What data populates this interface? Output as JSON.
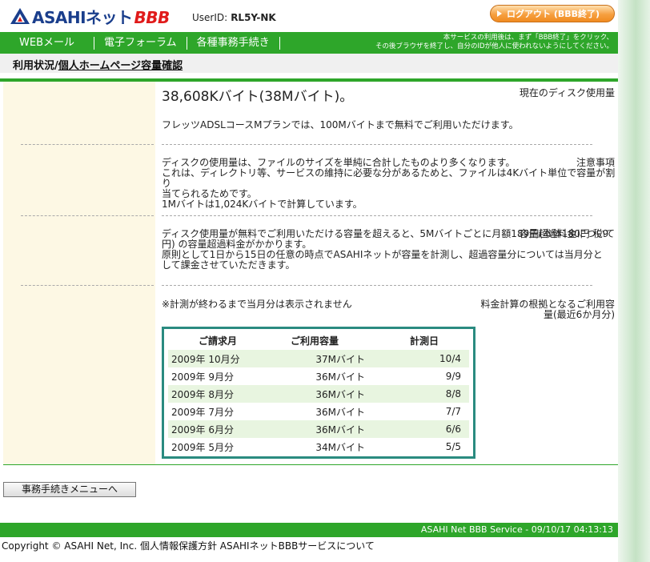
{
  "header": {
    "logo_main": "ASAHIネット",
    "logo_bbb": "BBB",
    "userid_label": "UserID:",
    "userid_value": "RL5Y-NK",
    "logout_label": "ログアウト (BBB終了)"
  },
  "nav": {
    "items": [
      {
        "label": "WEBメール"
      },
      {
        "label": "電子フォーラム"
      },
      {
        "label": "各種事務手続き"
      }
    ],
    "note_line1": "本サービスの利用後は、まず「BBB終了」をクリック、",
    "note_line2": "その後ブラウザを終了し、自分のIDが他人に使われないようにしてください。"
  },
  "breadcrumb": {
    "part1": "利用状況/",
    "part2": "個人ホームページ容量確認"
  },
  "rows": {
    "disk_label": "現在のディスク使用量",
    "disk_value": "38,608Kバイト(38Mバイト)。",
    "disk_note": "フレッツADSLコースMプランでは、100Mバイトまで無料でご利用いただけます。",
    "notice_label": "注意事項",
    "notice_line1": "ディスクの使用量は、ファイルのサイズを単純に合計したものより多くなります。",
    "notice_line2": "これは、ディレクトリ等、サービスの維持に必要な分があるためと、ファイルは4Kバイト単位で容量が割り",
    "notice_line3": "当てられるためです。",
    "notice_line4": "1Mバイトは1,024Kバイトで計算しています。",
    "fee_label": "容量超過料金について",
    "fee_line1": "ディスク使用量が無料でご利用いただける容量を超えると、5Mバイトごとに月額189円(本体180円 税9",
    "fee_line2": "円) の容量超過料金がかかります。",
    "fee_line3": "原則として1日から15日の任意の時点でASAHIネットが容量を計測し、超過容量分については当月分と",
    "fee_line4": "して課金させていただきます。",
    "basis_label_line1": "料金計算の根拠となるご利用容",
    "basis_label_line2": "量(最近6か月分)",
    "basis_note": "※計測が終わるまで当月分は表示されません"
  },
  "table": {
    "headers": [
      "ご請求月",
      "ご利用容量",
      "計測日"
    ],
    "rows": [
      [
        "2009年 10月分",
        "37Mバイト",
        "10/4"
      ],
      [
        "2009年 9月分",
        "36Mバイト",
        "9/9"
      ],
      [
        "2009年 8月分",
        "36Mバイト",
        "8/8"
      ],
      [
        "2009年 7月分",
        "36Mバイト",
        "7/7"
      ],
      [
        "2009年 6月分",
        "36Mバイト",
        "6/6"
      ],
      [
        "2009年 5月分",
        "34Mバイト",
        "5/5"
      ]
    ]
  },
  "menu_button_label": "事務手続きメニューへ",
  "footer": {
    "status": "ASAHI Net BBB Service - 09/10/17 04:13:13",
    "copyright": "Copyright © ASAHI Net, Inc. 個人情報保護方針 ASAHIネットBBBサービスについて"
  },
  "colors": {
    "brand_green": "#2ea62a",
    "table_border": "#2a8b80",
    "label_bg": "#fdf8e4",
    "logout_orange": "#f6a040"
  }
}
